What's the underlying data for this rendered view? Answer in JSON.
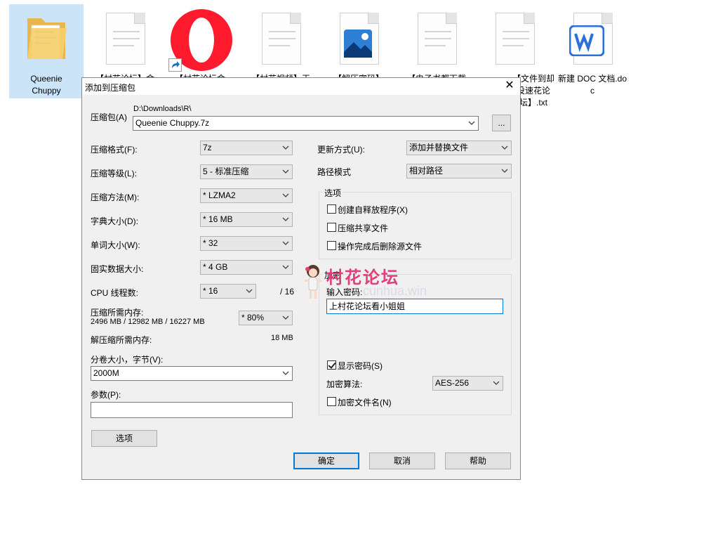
{
  "desktop": {
    "icons": [
      {
        "label": "Queenie\nChuppy",
        "icon": "folder-icon",
        "selected": true
      },
      {
        "label": "【村花论坛】金",
        "icon": "text-file-icon"
      },
      {
        "label": "【村花论坛金",
        "icon": "opera-icon",
        "shortcut": true
      },
      {
        "label": "【村花视频】王",
        "icon": "text-file-icon"
      },
      {
        "label": "【解压密码】",
        "icon": "image-file-icon"
      },
      {
        "label": "【电子书都下载",
        "icon": "text-file-icon"
      },
      {
        "label": "【文件到却没速花论坛】.txt",
        "icon": "text-file-icon"
      },
      {
        "label": "新建 DOC 文档.doc",
        "icon": "wps-doc-icon"
      }
    ]
  },
  "dialog": {
    "title": "添加到压缩包",
    "close_label": "✕",
    "archive_label": "压缩包(A)",
    "archive_path": "D:\\Downloads\\R\\",
    "archive_name": "Queenie Chuppy.7z",
    "browse_label": "...",
    "left_fields": [
      {
        "label": "压缩格式(F):",
        "value": "7z"
      },
      {
        "label": "压缩等级(L):",
        "value": "5 - 标准压缩"
      },
      {
        "label": "压缩方法(M):",
        "value": "* LZMA2"
      },
      {
        "label": "字典大小(D):",
        "value": "* 16 MB"
      },
      {
        "label": "单词大小(W):",
        "value": "* 32"
      },
      {
        "label": "固实数据大小:",
        "value": "* 4 GB"
      }
    ],
    "cpu_label": "CPU 线程数:",
    "cpu_value": "* 16",
    "cpu_max": "/ 16",
    "mem_label": "压缩所需内存:",
    "mem_detail": "2496 MB / 12982 MB / 16227 MB",
    "mem_value": "* 80%",
    "decomp_label": "解压缩所需内存:",
    "decomp_value": "18 MB",
    "split_label": "分卷大小，字节(V):",
    "split_value": "2000M",
    "params_label": "参数(P):",
    "params_value": "",
    "options_button": "选项",
    "update_label": "更新方式(U):",
    "update_value": "添加并替换文件",
    "path_label": "路径模式",
    "path_value": "相对路径",
    "options_group": {
      "title": "选项",
      "items": [
        {
          "label": "创建自释放程序(X)",
          "checked": false
        },
        {
          "label": "压缩共享文件",
          "checked": false
        },
        {
          "label": "操作完成后删除源文件",
          "checked": false
        }
      ]
    },
    "encrypt_group": {
      "title": "加密",
      "password_label": "输入密码:",
      "password_value": "上村花论坛看小姐姐",
      "show_password_label": "显示密码(S)",
      "show_password_checked": true,
      "method_label": "加密算法:",
      "method_value": "AES-256",
      "encrypt_names_label": "加密文件名(N)",
      "encrypt_names_checked": false
    },
    "ok_label": "确定",
    "cancel_label": "取消",
    "help_label": "帮助"
  },
  "watermark": {
    "text": "村花论坛",
    "url": "cunhua.win"
  },
  "colors": {
    "dialog_bg": "#f0f0f0",
    "accent": "#0078d7",
    "selection": "#cce4f7",
    "watermark": "#e0407a"
  }
}
